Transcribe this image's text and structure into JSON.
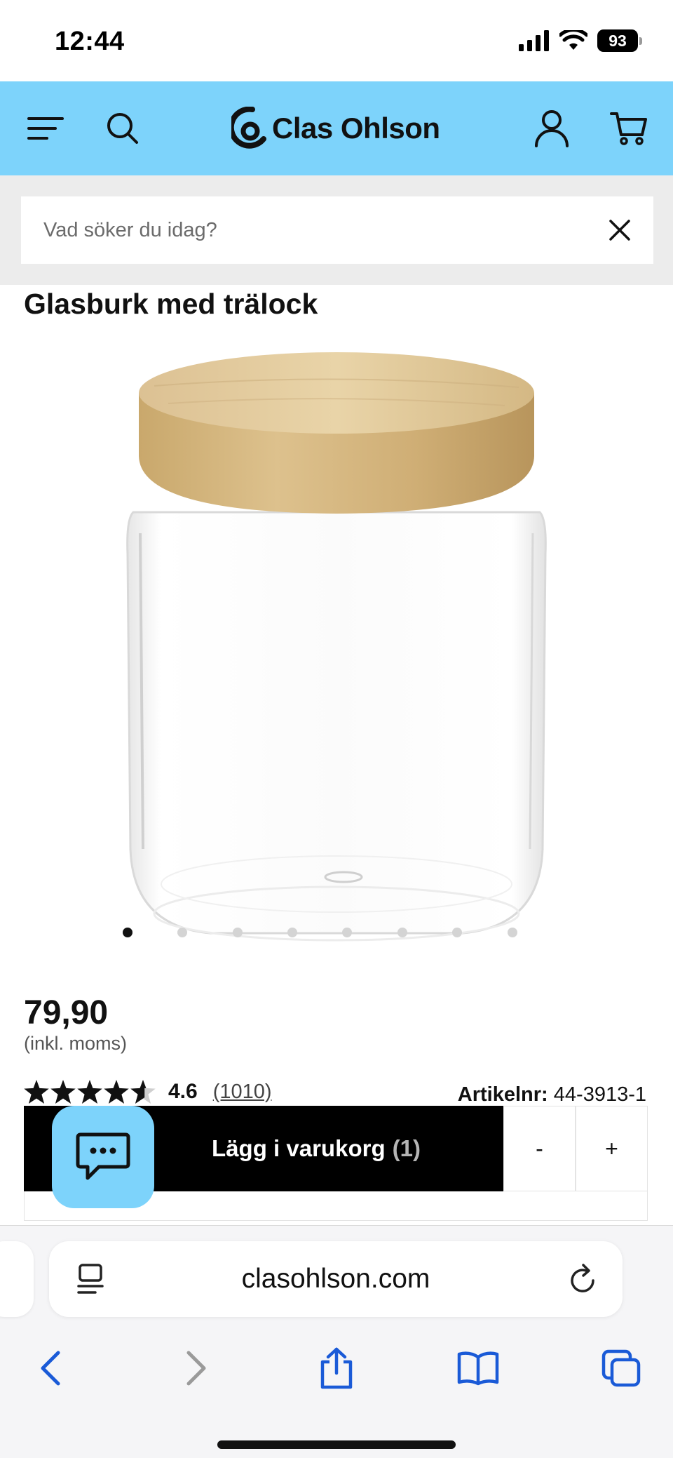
{
  "status_bar": {
    "time": "12:44",
    "battery": "93"
  },
  "header": {
    "brand": "Clas Ohlson"
  },
  "search": {
    "placeholder": "Vad söker du idag?"
  },
  "product": {
    "title": "Glasburk med trälock",
    "price": "79,90",
    "price_note": "(inkl. moms)",
    "rating": 4.6,
    "rating_label": "4.6",
    "reviews": "(1010)",
    "sku_label": "Artikelnr:",
    "sku": "44-3913-1",
    "image_count": 8,
    "active_image_index": 0
  },
  "cart": {
    "add_label": "Lägg i varukorg",
    "quantity": "(1)",
    "decrease": "-",
    "increase": "+"
  },
  "browser": {
    "url": "clasohlson.com"
  },
  "icons": {
    "menu": "menu-icon",
    "search": "search-icon",
    "account": "user-icon",
    "cart": "cart-icon",
    "clear": "close-icon",
    "chat": "chat-icon",
    "reader": "reader-icon",
    "reload": "reload-icon",
    "back": "back-icon",
    "forward": "forward-icon",
    "share": "share-icon",
    "bookmarks": "bookmarks-icon",
    "tabs": "tabs-icon"
  },
  "colors": {
    "brand": "#7dd3fb",
    "button": "#000000",
    "link": "#1a5ad7"
  }
}
